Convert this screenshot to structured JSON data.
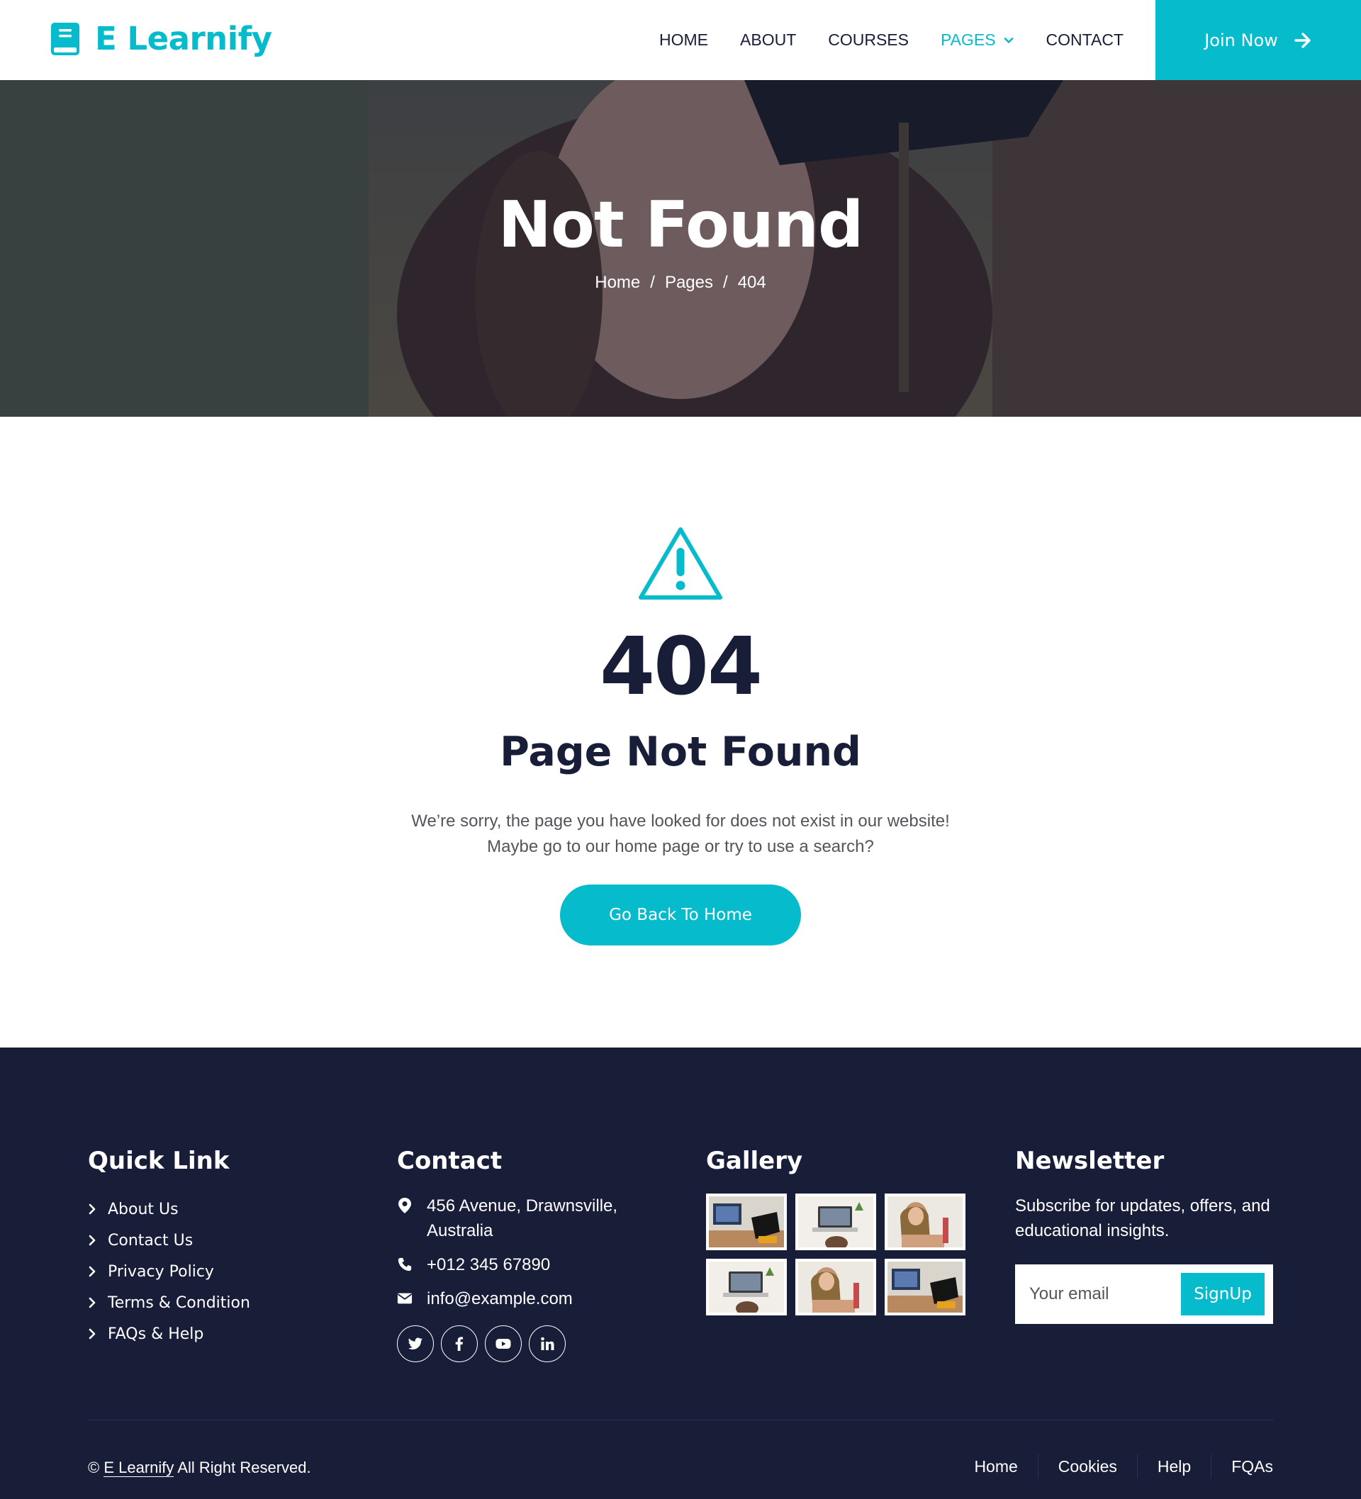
{
  "brand": {
    "name": "E Learnify"
  },
  "nav": {
    "items": [
      {
        "label": "HOME",
        "active": false
      },
      {
        "label": "ABOUT",
        "active": false
      },
      {
        "label": "COURSES",
        "active": false
      },
      {
        "label": "PAGES",
        "active": true
      },
      {
        "label": "CONTACT",
        "active": false
      }
    ],
    "join_label": "Join Now"
  },
  "hero": {
    "title": "Not Found",
    "breadcrumb": [
      "Home",
      "Pages",
      "404"
    ],
    "separator": "/"
  },
  "error": {
    "code": "404",
    "title": "Page Not Found",
    "line1": "We’re sorry, the page you have looked for does not exist in our website!",
    "line2": "Maybe go to our home page or try to use a search?",
    "button_label": "Go Back To Home"
  },
  "footer": {
    "quick_link": {
      "heading": "Quick Link",
      "items": [
        "About Us",
        "Contact Us",
        "Privacy Policy",
        "Terms & Condition",
        "FAQs & Help"
      ]
    },
    "contact": {
      "heading": "Contact",
      "address": "456 Avenue, Drawnsville, Australia",
      "phone": "+012 345 67890",
      "email": "info@example.com",
      "socials": [
        "twitter-icon",
        "facebook-icon",
        "youtube-icon",
        "linkedin-icon"
      ]
    },
    "gallery": {
      "heading": "Gallery",
      "images": [
        "course-image-1",
        "course-image-2",
        "course-image-3",
        "course-image-2",
        "course-image-3",
        "course-image-1"
      ]
    },
    "newsletter": {
      "heading": "Newsletter",
      "text": "Subscribe for updates, offers, and educational insights.",
      "placeholder": "Your email",
      "button_label": "SignUp"
    },
    "copyright": {
      "prefix": "©",
      "brand": "E Learnify",
      "suffix": "All Right Reserved."
    },
    "links": [
      "Home",
      "Cookies",
      "Help",
      "FQAs"
    ]
  },
  "colors": {
    "accent": "#06bbcc",
    "dark": "#181d38",
    "text_muted": "#52565b"
  }
}
